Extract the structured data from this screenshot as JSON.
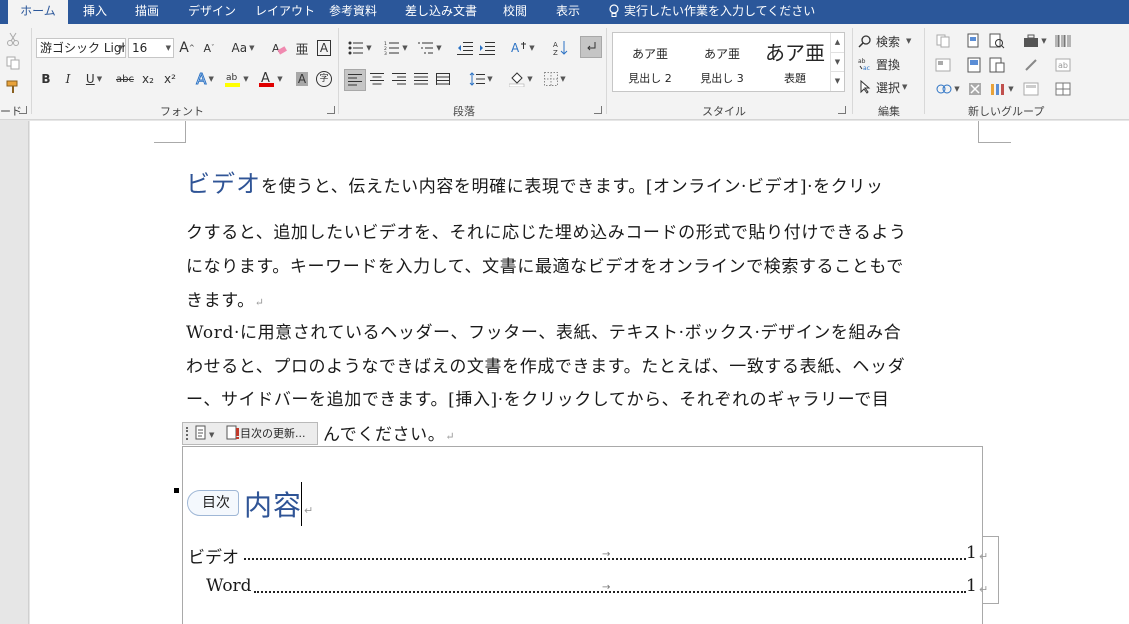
{
  "tabs": [
    {
      "label": "ホーム",
      "active": true
    },
    {
      "label": "挿入"
    },
    {
      "label": "描画"
    },
    {
      "label": "デザイン"
    },
    {
      "label": "レイアウト"
    },
    {
      "label": "参考資料"
    },
    {
      "label": "差し込み文書"
    },
    {
      "label": "校閲"
    },
    {
      "label": "表示"
    }
  ],
  "tell_me": "実行したい作業を入力してください",
  "clipboard": {
    "label_fragment": "ード"
  },
  "font": {
    "name": "游ゴシック Ligh",
    "size": "16",
    "group_label": "フォント",
    "case_label": "Aa",
    "bold": "B",
    "italic": "I",
    "underline": "U",
    "strike": "abc",
    "subscript": "x₂",
    "superscript": "x²",
    "highlight_color": "#ffff00",
    "font_color": "#e00000"
  },
  "paragraph": {
    "group_label": "段落"
  },
  "styles": {
    "group_label": "スタイル",
    "items": [
      {
        "preview": "あア亜",
        "name": "見出し 2"
      },
      {
        "preview": "あア亜",
        "name": "見出し 3"
      },
      {
        "preview": "あア亜",
        "name": "表題"
      }
    ]
  },
  "editing": {
    "group_label": "編集",
    "find": "検索",
    "replace": "置換",
    "select": "選択"
  },
  "new_group": {
    "group_label": "新しいグループ"
  },
  "document": {
    "para1_heading_word": "ビデオ",
    "para1_rest": "を使うと、伝えたい内容を明確に表現できます。[オンライン·ビデオ]·をクリッ",
    "para1_line2": "クすると、追加したいビデオを、それに応じた埋め込みコードの形式で貼り付けできるよう",
    "para1_line3": "になります。キーワードを入力して、文書に最適なビデオをオンラインで検索することもで",
    "para1_line4": "きます。",
    "para2_line1": "Word·に用意されているヘッダー、フッター、表紙、テキスト·ボックス·デザインを組み合",
    "para2_line2": "わせると、プロのようなできばえの文書を作成できます。たとえば、一致する表紙、ヘッダ",
    "para2_line3": "ー、サイドバーを追加できます。[挿入]·をクリックしてから、それぞれのギャラリーで目",
    "para2_line4": "んでください。",
    "paragraph_mark": "↵"
  },
  "toc": {
    "toolbar_update": "目次の更新...",
    "tag": "目次",
    "heading": "内容",
    "entries": [
      {
        "text": "ビデオ",
        "page": "1"
      },
      {
        "text": "Word",
        "page": "1"
      }
    ]
  }
}
